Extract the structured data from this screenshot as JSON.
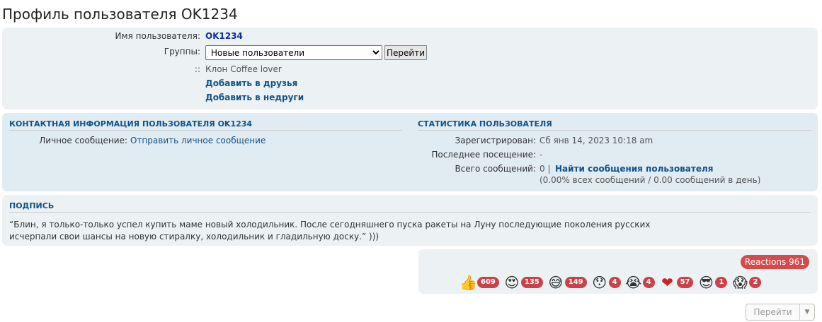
{
  "page": {
    "title": "Профиль пользователя OK1234"
  },
  "profile": {
    "username_label": "Имя пользователя:",
    "username": "OK1234",
    "groups_label": "Группы:",
    "groups_selected": "Новые пользователи",
    "go_button": "Перейти",
    "rank_prefix": "::",
    "rank": "Клон Coffee lover",
    "add_friend": "Добавить в друзья",
    "add_foe": "Добавить в недруги"
  },
  "contact": {
    "header": "КОНТАКТНАЯ ИНФОРМАЦИЯ ПОЛЬЗОВАТЕЛЯ OK1234",
    "pm_label": "Личное сообщение:",
    "pm_link": "Отправить личное сообщение"
  },
  "stats": {
    "header": "СТАТИСТИКА ПОЛЬЗОВАТЕЛЯ",
    "registered_label": "Зарегистрирован:",
    "registered_value": "Сб янв 14, 2023 10:18 am",
    "last_visit_label": "Последнее посещение:",
    "last_visit_value": "-",
    "posts_label": "Всего сообщений:",
    "posts_count": "0 |",
    "posts_link": "Найти сообщения пользователя",
    "posts_detail": "(0.00% всех сообщений / 0.00 сообщений в день)"
  },
  "signature": {
    "header": "ПОДПИСЬ",
    "line1": "“Блин, я только-только успел купить маме новый холодильник. После сегодняшнего пуска ракеты на Луну последующие поколения русских",
    "line2": "исчерпали свои шансы на новую стиралку, холодильник и гладильную доску.” )))"
  },
  "reactions": {
    "total": "Reactions 961",
    "items": [
      {
        "icon": "thumbs-up-icon",
        "glyph": "👍",
        "count": "609"
      },
      {
        "icon": "heart-eyes-icon",
        "glyph": "😍",
        "count": "135"
      },
      {
        "icon": "grin-sweat-icon",
        "glyph": "😅",
        "count": "149"
      },
      {
        "icon": "surprised-icon",
        "glyph": "😯",
        "count": "4"
      },
      {
        "icon": "crying-icon",
        "glyph": "😭",
        "count": "4"
      },
      {
        "icon": "heart-icon",
        "glyph": "❤",
        "count": "57"
      },
      {
        "icon": "sunglasses-icon",
        "glyph": "😎",
        "count": "1"
      },
      {
        "icon": "scream-icon",
        "glyph": "😱",
        "count": "2"
      }
    ]
  },
  "jump": {
    "label": "Перейти"
  },
  "colors": {
    "panel": "#ecf1f3",
    "panel_dark": "#e1ebf2",
    "link": "#105289",
    "username": "#0d2f9a",
    "reaction_badge": "#c9424a"
  }
}
